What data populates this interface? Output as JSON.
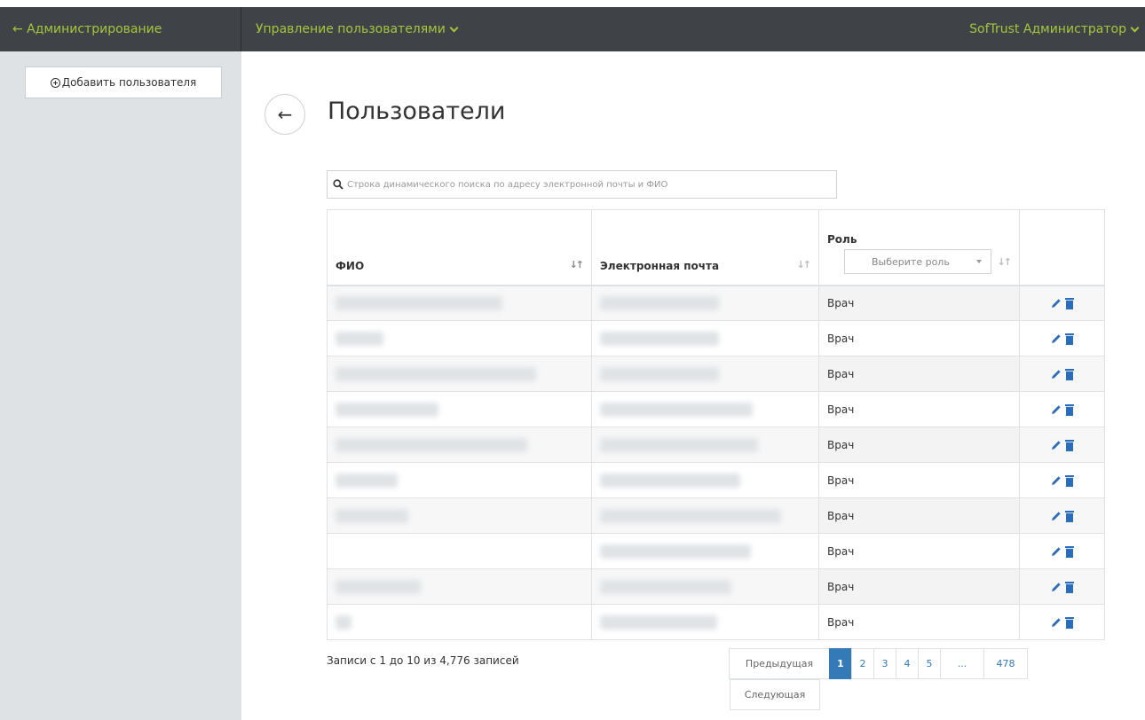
{
  "topbar": {
    "back_label": "← Администрирование",
    "menu_label": "Управление пользователями",
    "user_label": "SofTrust Администратор"
  },
  "sidebar": {
    "add_user_label": "Добавить пользователя"
  },
  "page": {
    "title": "Пользователи"
  },
  "search": {
    "placeholder": "Строка динамического поиска по адресу электронной почты и ФИО"
  },
  "table": {
    "columns": {
      "fio": "ФИО",
      "email": "Электронная почта",
      "role": "Роль"
    },
    "role_filter_placeholder": "Выберите роль",
    "rows": [
      {
        "role": "Врач"
      },
      {
        "role": "Врач"
      },
      {
        "role": "Врач"
      },
      {
        "role": "Врач"
      },
      {
        "role": "Врач"
      },
      {
        "role": "Врач"
      },
      {
        "role": "Врач"
      },
      {
        "role": "Врач"
      },
      {
        "role": "Врач"
      },
      {
        "role": "Врач"
      }
    ]
  },
  "footer": {
    "records_info": "Записи с 1 до 10 из 4,776 записей",
    "prev_label": "Предыдущая",
    "next_label": "Следующая",
    "pages": [
      "1",
      "2",
      "3",
      "4",
      "5",
      "...",
      "478"
    ],
    "active_page": "1"
  },
  "colors": {
    "topbar_bg": "#3f4347",
    "topbar_link": "#a5c63b",
    "sidebar_bg": "#dee2e5",
    "accent": "#337ab7",
    "icon": "#2a6ebb"
  }
}
